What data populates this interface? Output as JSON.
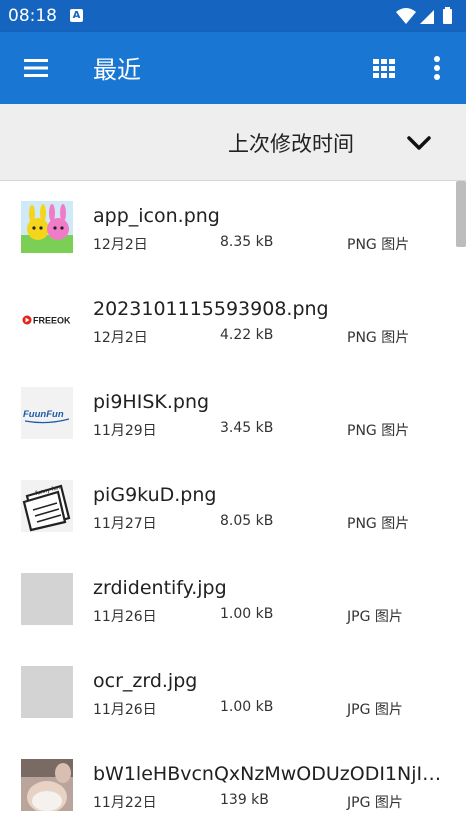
{
  "status": {
    "time": "08:18",
    "notif_icon": "A"
  },
  "appbar": {
    "title": "最近",
    "menu_icon": "hamburger-menu-icon",
    "grid_icon": "grid-view-icon",
    "more_icon": "more-vert-icon"
  },
  "sort": {
    "label": "上次修改时间",
    "chevron_icon": "chevron-down-icon"
  },
  "files": [
    {
      "name": "app_icon.png",
      "date": "12月2日",
      "size": "8.35 kB",
      "type": "PNG 图片",
      "thumb": "cartoon-bunnies-thumbnail"
    },
    {
      "name": "2023101115593908.png",
      "date": "12月2日",
      "size": "4.22 kB",
      "type": "PNG 图片",
      "thumb": "freeok-logo-thumbnail"
    },
    {
      "name": "pi9HISK.png",
      "date": "11月29日",
      "size": "3.45 kB",
      "type": "PNG 图片",
      "thumb": "fuunfun-logo-thumbnail"
    },
    {
      "name": "piG9kuD.png",
      "date": "11月27日",
      "size": "8.05 kB",
      "type": "PNG 图片",
      "thumb": "newspaper-icon-thumbnail"
    },
    {
      "name": "zrdidentify.jpg",
      "date": "11月26日",
      "size": "1.00 kB",
      "type": "JPG 图片",
      "thumb": "blank-gray-thumbnail"
    },
    {
      "name": "ocr_zrd.jpg",
      "date": "11月26日",
      "size": "1.00 kB",
      "type": "JPG 图片",
      "thumb": "blank-gray-thumbnail"
    },
    {
      "name": "bW1leHBvcnQxNzMwODUzODI1NjI3...",
      "date": "11月22日",
      "size": "139 kB",
      "type": "JPG 图片",
      "thumb": "photo-thumbnail"
    }
  ],
  "thumb_texts": {
    "freeok": "FREEOK",
    "fuunfun": "FuunFun",
    "newspaper": "funny-fun"
  },
  "colors": {
    "statusbar": "#1565c0",
    "appbar": "#1976d2",
    "sortbar": "#eeeeee"
  }
}
